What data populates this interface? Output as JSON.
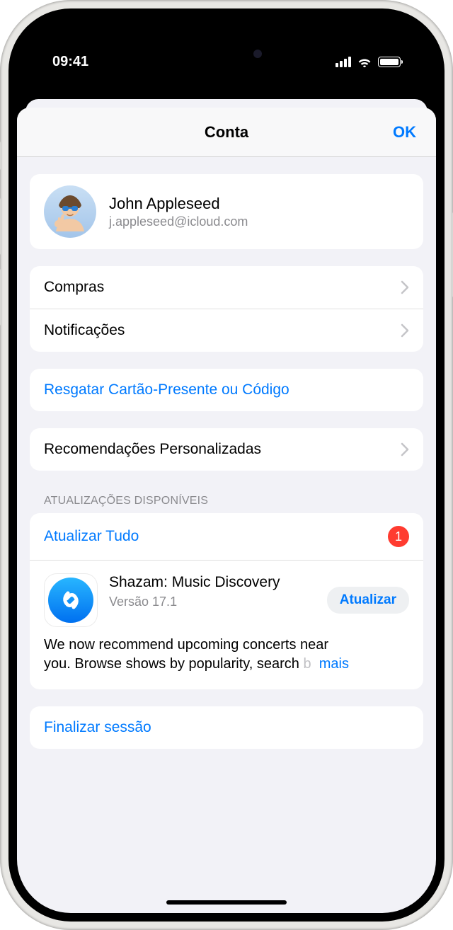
{
  "status": {
    "time": "09:41"
  },
  "nav": {
    "title": "Conta",
    "ok": "OK"
  },
  "profile": {
    "name": "John Appleseed",
    "email": "j.appleseed@icloud.com"
  },
  "menu": {
    "purchases": "Compras",
    "notifications": "Notificações",
    "redeem": "Resgatar Cartão-Presente ou Código",
    "personalized": "Recomendações Personalizadas"
  },
  "updates": {
    "section_header": "ATUALIZAÇÕES DISPONÍVEIS",
    "update_all": "Atualizar Tudo",
    "badge_count": "1",
    "app": {
      "name": "Shazam: Music Discovery",
      "version": "Versão 17.1",
      "update_button": "Atualizar",
      "notes_line1": "We now recommend upcoming concerts near",
      "notes_line2a": "you. Browse shows by popularity, search ",
      "notes_line2b_fade": "b",
      "more": "mais"
    }
  },
  "signout": "Finalizar sessão"
}
